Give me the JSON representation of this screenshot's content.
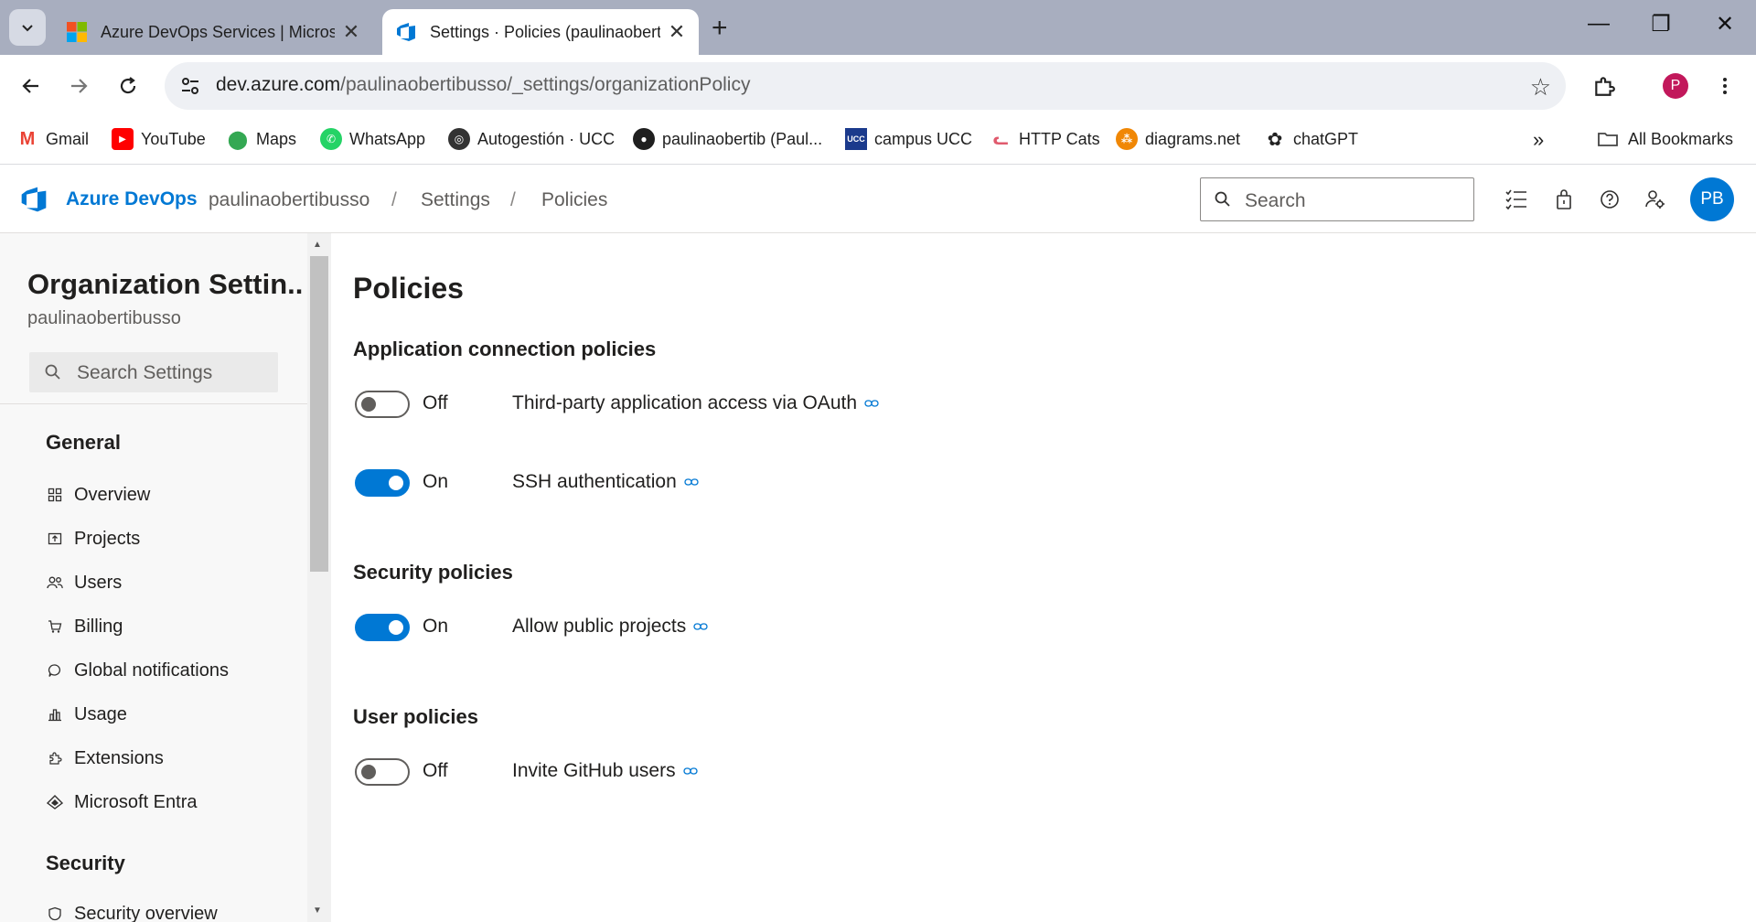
{
  "browser": {
    "tabs": [
      {
        "title": "Azure DevOps Services | Microsoft",
        "favicon": "microsoft-logo-icon",
        "active": false
      },
      {
        "title": "Settings · Policies (paulinaobertibusso)",
        "favicon": "azure-devops-icon",
        "active": true
      }
    ],
    "url_host": "dev.azure.com",
    "url_path": "/paulinaobertibusso/_settings/organizationPolicy",
    "profile_initial": "P",
    "bookmarks": [
      {
        "label": "Gmail",
        "icon": "gmail-icon"
      },
      {
        "label": "YouTube",
        "icon": "youtube-icon"
      },
      {
        "label": "Maps",
        "icon": "maps-icon"
      },
      {
        "label": "WhatsApp",
        "icon": "whatsapp-icon"
      },
      {
        "label": "Autogestión · UCC",
        "icon": "globe-icon"
      },
      {
        "label": "paulinaobertib (Paul...",
        "icon": "github-icon"
      },
      {
        "label": "campus UCC",
        "icon": "ucc-icon"
      },
      {
        "label": "HTTP Cats",
        "icon": "cat-icon"
      },
      {
        "label": "diagrams.net",
        "icon": "diagrams-icon"
      },
      {
        "label": "chatGPT",
        "icon": "openai-icon"
      }
    ],
    "all_bookmarks": "All Bookmarks"
  },
  "ado": {
    "brand": "Azure DevOps",
    "breadcrumb": [
      "paulinaobertibusso",
      "Settings",
      "Policies"
    ],
    "search_placeholder": "Search",
    "avatar_initials": "PB"
  },
  "sidebar": {
    "title": "Organization Settin...",
    "subtitle": "paulinaobertibusso",
    "search_placeholder": "Search Settings",
    "sections": [
      {
        "heading": "General",
        "items": [
          {
            "label": "Overview",
            "icon": "overview-icon"
          },
          {
            "label": "Projects",
            "icon": "projects-icon"
          },
          {
            "label": "Users",
            "icon": "users-icon"
          },
          {
            "label": "Billing",
            "icon": "cart-icon"
          },
          {
            "label": "Global notifications",
            "icon": "chat-icon"
          },
          {
            "label": "Usage",
            "icon": "usage-icon"
          },
          {
            "label": "Extensions",
            "icon": "puzzle-icon"
          },
          {
            "label": "Microsoft Entra",
            "icon": "entra-icon"
          }
        ]
      },
      {
        "heading": "Security",
        "items": [
          {
            "label": "Security overview",
            "icon": "shield-icon"
          }
        ]
      }
    ]
  },
  "main": {
    "title": "Policies",
    "groups": [
      {
        "title": "Application connection policies",
        "policies": [
          {
            "state": "Off",
            "label": "Third-party application access via OAuth"
          },
          {
            "state": "On",
            "label": "SSH authentication"
          }
        ]
      },
      {
        "title": "Security policies",
        "policies": [
          {
            "state": "On",
            "label": "Allow public projects"
          }
        ]
      },
      {
        "title": "User policies",
        "policies": [
          {
            "state": "Off",
            "label": "Invite GitHub users"
          }
        ]
      }
    ]
  },
  "colors": {
    "accent": "#0078d4",
    "tabbar": "#a8aebf",
    "toggle_off": "#605e5c"
  }
}
